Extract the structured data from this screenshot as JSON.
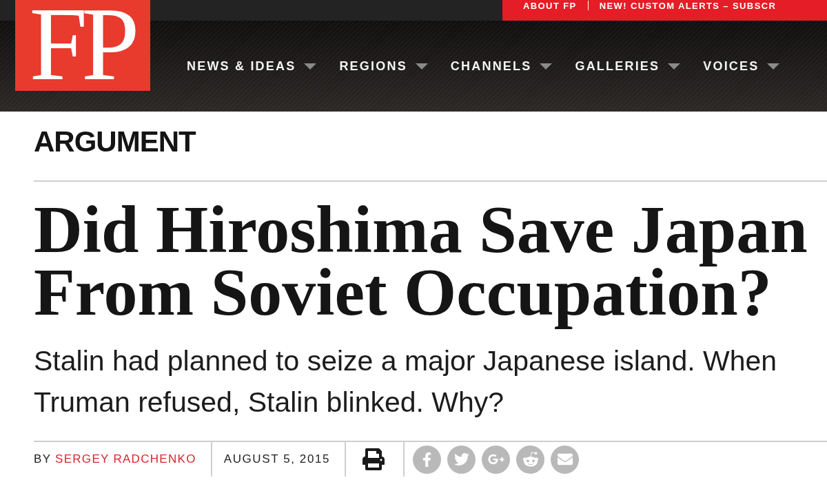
{
  "logo": {
    "text": "FP"
  },
  "utility_links": [
    {
      "label": "ABOUT FP"
    },
    {
      "label": "NEW! CUSTOM ALERTS – SUBSCR"
    }
  ],
  "nav": [
    {
      "label": "NEWS & IDEAS"
    },
    {
      "label": "REGIONS"
    },
    {
      "label": "CHANNELS"
    },
    {
      "label": "GALLERIES"
    },
    {
      "label": "VOICES"
    }
  ],
  "article": {
    "section": "ARGUMENT",
    "headline": "Did Hiroshima Save Japan From Soviet Occupation?",
    "dek": "Stalin had planned to seize a major Japanese island. When Truman refused, Stalin blinked. Why?",
    "byline": {
      "prefix": "BY",
      "author": "SERGEY RADCHENKO"
    },
    "date": "AUGUST 5, 2015",
    "tools": [
      {
        "kind": "print"
      }
    ],
    "share": [
      {
        "kind": "facebook"
      },
      {
        "kind": "twitter"
      },
      {
        "kind": "google_plus"
      },
      {
        "kind": "reddit"
      },
      {
        "kind": "email"
      }
    ]
  }
}
